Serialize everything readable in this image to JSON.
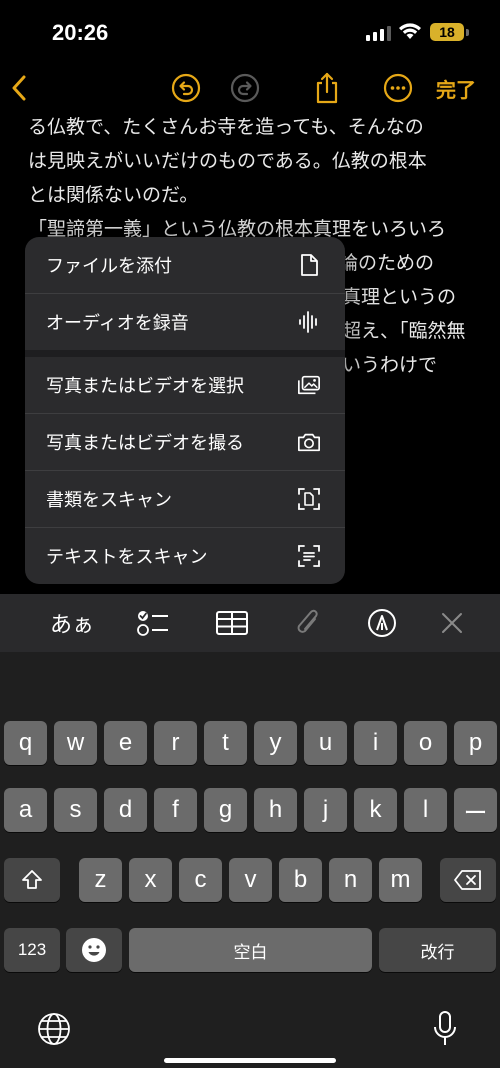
{
  "status": {
    "time": "20:26",
    "battery": "18"
  },
  "nav": {
    "done_label": "完了"
  },
  "note": {
    "lines": [
      "る仏教で、たくさんお寺を造っても、そんなの",
      "は見映えがいいだけのものである。仏教の根本",
      "とは関係ないのだ。",
      "「聖諦第一義」という仏教の根本真理をいろいろ",
      "議論のための",
      "真理というの",
      "超え、「臨然無",
      "いうわけで"
    ]
  },
  "menu": {
    "items": [
      {
        "label": "ファイルを添付",
        "icon": "document-icon"
      },
      {
        "label": "オーディオを録音",
        "icon": "waveform-icon"
      },
      {
        "label": "写真またはビデオを選択",
        "icon": "photo-library-icon"
      },
      {
        "label": "写真またはビデオを撮る",
        "icon": "camera-icon"
      },
      {
        "label": "書類をスキャン",
        "icon": "scan-document-icon"
      },
      {
        "label": "テキストをスキャン",
        "icon": "scan-text-icon"
      }
    ]
  },
  "toolbar": {
    "aa_label": "あぁ"
  },
  "keyboard": {
    "row1": [
      "q",
      "w",
      "e",
      "r",
      "t",
      "y",
      "u",
      "i",
      "o",
      "p"
    ],
    "row2": [
      "a",
      "s",
      "d",
      "f",
      "g",
      "h",
      "j",
      "k",
      "l",
      "ー"
    ],
    "row3": [
      "z",
      "x",
      "c",
      "v",
      "b",
      "n",
      "m"
    ],
    "numbers_key": "123",
    "space_key": "空白",
    "return_key": "改行"
  },
  "colors": {
    "accent": "#e6a817",
    "menu_bg": "#2b2b2d",
    "key": "#6b6b6b",
    "key_dark": "#464646"
  }
}
